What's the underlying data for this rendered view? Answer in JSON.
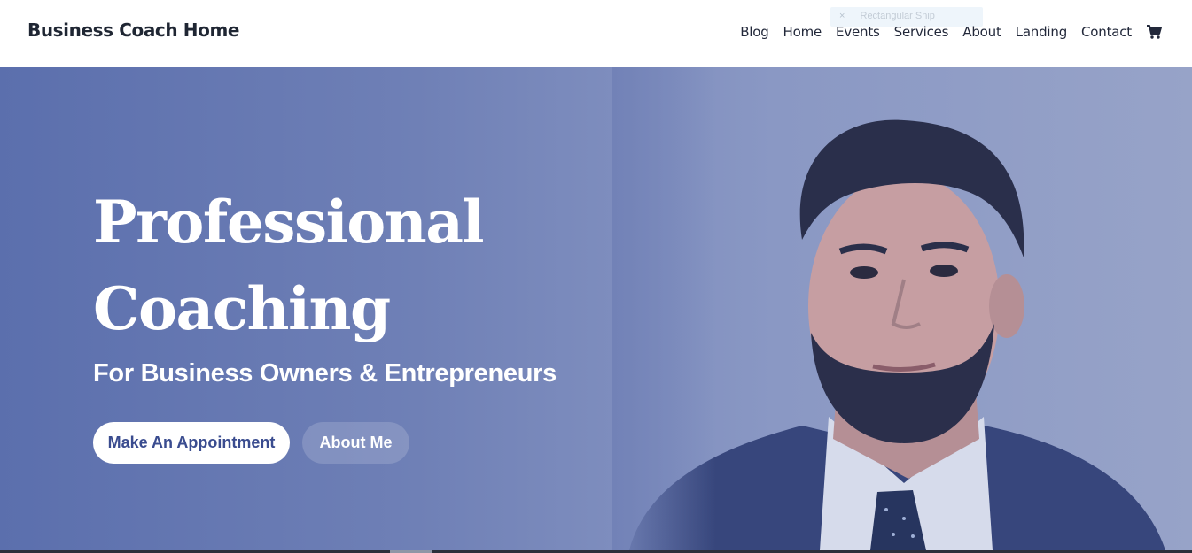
{
  "header": {
    "brand": "Business Coach Home",
    "nav": [
      "Blog",
      "Home",
      "Events",
      "Services",
      "About",
      "Landing",
      "Contact"
    ],
    "cart_icon": "shopping-cart-icon"
  },
  "snip_overlay": {
    "close": "×",
    "label": "Rectangular Snip"
  },
  "hero": {
    "title_line1": "Professional",
    "title_line2": "Coaching",
    "subtitle": "For Business Owners & Entrepreneurs",
    "primary_button": "Make An Appointment",
    "secondary_button": "About Me"
  },
  "colors": {
    "hero_start": "#5b6fad",
    "hero_end": "#97a3c8",
    "brand_text": "#1f2633",
    "button_text": "#3a4c8f"
  }
}
